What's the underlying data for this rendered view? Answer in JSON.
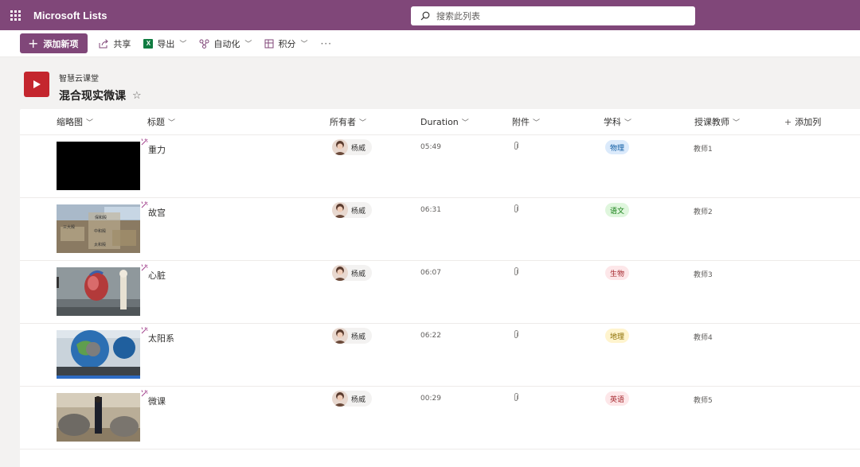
{
  "app": {
    "title": "Microsoft Lists"
  },
  "search": {
    "placeholder": "搜索此列表"
  },
  "commands": {
    "new_item": "添加新项",
    "share": "共享",
    "export": "导出",
    "automate": "自动化",
    "integrate": "积分",
    "more": "···"
  },
  "site": {
    "name": "智慧云课堂"
  },
  "list": {
    "title": "混合现实微课"
  },
  "columns": {
    "thumbnail": "缩略图",
    "title": "标题",
    "owner": "所有者",
    "duration": "Duration",
    "attachments": "附件",
    "subject": "学科",
    "teacher": "授课教师",
    "add_column": "添加列"
  },
  "rows": [
    {
      "title": "重力",
      "owner": "杨威",
      "duration": "05:49",
      "subject": "物理",
      "subject_bg": "#dbeafb",
      "subject_fg": "#0b5aa2",
      "teacher": "教师1",
      "thumb": "black"
    },
    {
      "title": "故宫",
      "owner": "杨威",
      "duration": "06:31",
      "subject": "语文",
      "subject_bg": "#dff6dd",
      "subject_fg": "#107c10",
      "teacher": "教师2",
      "thumb": "palace"
    },
    {
      "title": "心脏",
      "owner": "杨威",
      "duration": "06:07",
      "subject": "生物",
      "subject_bg": "#fde7e9",
      "subject_fg": "#a4262c",
      "teacher": "教师3",
      "thumb": "heart"
    },
    {
      "title": "太阳系",
      "owner": "杨威",
      "duration": "06:22",
      "subject": "地理",
      "subject_bg": "#fff4ce",
      "subject_fg": "#8a6d00",
      "teacher": "教师4",
      "thumb": "globe"
    },
    {
      "title": "微课",
      "owner": "杨威",
      "duration": "00:29",
      "subject": "英语",
      "subject_bg": "#fde7e9",
      "subject_fg": "#a4262c",
      "teacher": "教师5",
      "thumb": "elephant"
    }
  ],
  "colors": {
    "brand": "#804779",
    "list_icon": "#c4262e"
  }
}
